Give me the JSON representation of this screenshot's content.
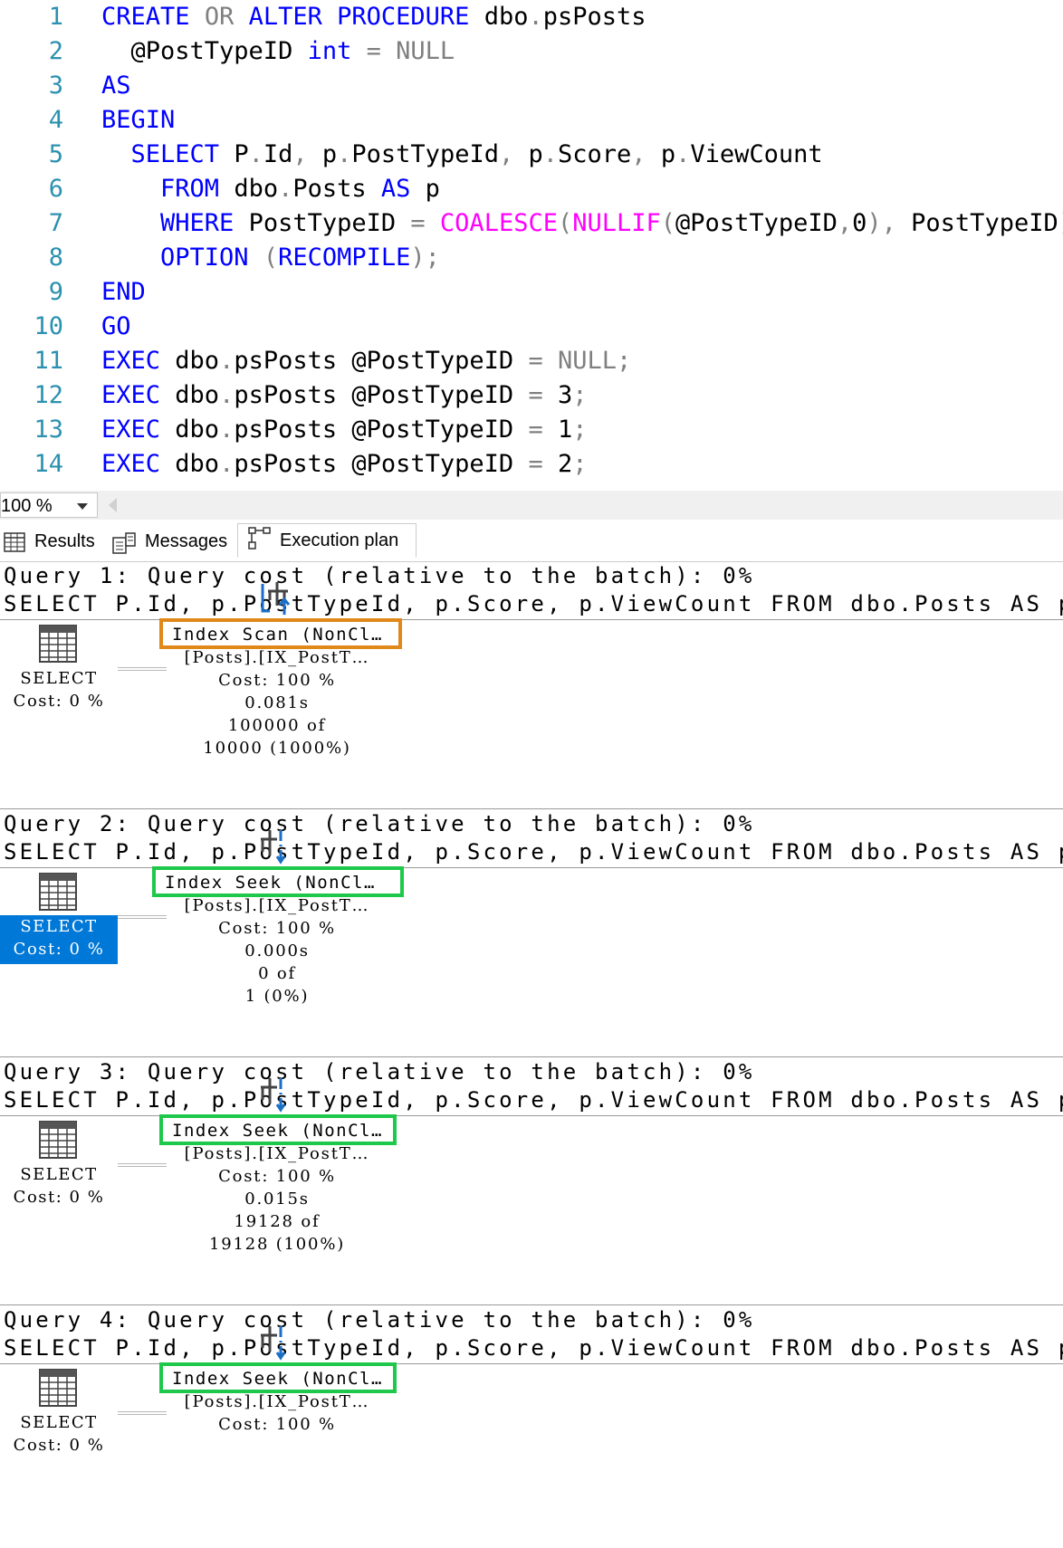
{
  "editor": {
    "lines": [
      {
        "n": "1",
        "tokens": [
          {
            "t": "CREATE",
            "c": "kw"
          },
          {
            "t": " "
          },
          {
            "t": "OR",
            "c": "op"
          },
          {
            "t": " "
          },
          {
            "t": "ALTER",
            "c": "kw"
          },
          {
            "t": " "
          },
          {
            "t": "PROCEDURE",
            "c": "kw"
          },
          {
            "t": " dbo"
          },
          {
            "t": ".",
            "c": "op"
          },
          {
            "t": "psPosts"
          }
        ]
      },
      {
        "n": "2",
        "tokens": [
          {
            "t": "  @PostTypeID "
          },
          {
            "t": "int",
            "c": "kw"
          },
          {
            "t": " "
          },
          {
            "t": "=",
            "c": "op"
          },
          {
            "t": " "
          },
          {
            "t": "NULL",
            "c": "op"
          }
        ]
      },
      {
        "n": "3",
        "tokens": [
          {
            "t": "AS",
            "c": "kw"
          }
        ]
      },
      {
        "n": "4",
        "tokens": [
          {
            "t": "BEGIN",
            "c": "kw"
          }
        ]
      },
      {
        "n": "5",
        "tokens": [
          {
            "t": "  "
          },
          {
            "t": "SELECT",
            "c": "kw"
          },
          {
            "t": " P"
          },
          {
            "t": ".",
            "c": "op"
          },
          {
            "t": "Id"
          },
          {
            "t": ",",
            "c": "op"
          },
          {
            "t": " p"
          },
          {
            "t": ".",
            "c": "op"
          },
          {
            "t": "PostTypeId"
          },
          {
            "t": ",",
            "c": "op"
          },
          {
            "t": " p"
          },
          {
            "t": ".",
            "c": "op"
          },
          {
            "t": "Score"
          },
          {
            "t": ",",
            "c": "op"
          },
          {
            "t": " p"
          },
          {
            "t": ".",
            "c": "op"
          },
          {
            "t": "ViewCount"
          }
        ]
      },
      {
        "n": "6",
        "tokens": [
          {
            "t": "    "
          },
          {
            "t": "FROM",
            "c": "kw"
          },
          {
            "t": " dbo"
          },
          {
            "t": ".",
            "c": "op"
          },
          {
            "t": "Posts "
          },
          {
            "t": "AS",
            "c": "kw"
          },
          {
            "t": " p"
          }
        ]
      },
      {
        "n": "7",
        "tokens": [
          {
            "t": "    "
          },
          {
            "t": "WHERE",
            "c": "kw"
          },
          {
            "t": " PostTypeID "
          },
          {
            "t": "=",
            "c": "op"
          },
          {
            "t": " "
          },
          {
            "t": "COALESCE",
            "c": "fn"
          },
          {
            "t": "(",
            "c": "op"
          },
          {
            "t": "NULLIF",
            "c": "fn"
          },
          {
            "t": "(",
            "c": "op"
          },
          {
            "t": "@PostTypeID"
          },
          {
            "t": ",",
            "c": "op"
          },
          {
            "t": "0"
          },
          {
            "t": "),",
            "c": "op"
          },
          {
            "t": " PostTypeID"
          },
          {
            "t": ")",
            "c": "op"
          }
        ]
      },
      {
        "n": "8",
        "tokens": [
          {
            "t": "    "
          },
          {
            "t": "OPTION",
            "c": "kw"
          },
          {
            "t": " "
          },
          {
            "t": "(",
            "c": "op"
          },
          {
            "t": "RECOMPILE",
            "c": "kw"
          },
          {
            "t": ");",
            "c": "op"
          }
        ]
      },
      {
        "n": "9",
        "tokens": [
          {
            "t": "END",
            "c": "kw"
          }
        ]
      },
      {
        "n": "10",
        "tokens": [
          {
            "t": "GO",
            "c": "kw"
          }
        ]
      },
      {
        "n": "11",
        "tokens": [
          {
            "t": "EXEC",
            "c": "kw"
          },
          {
            "t": " dbo"
          },
          {
            "t": ".",
            "c": "op"
          },
          {
            "t": "psPosts @PostTypeID "
          },
          {
            "t": "=",
            "c": "op"
          },
          {
            "t": " "
          },
          {
            "t": "NULL;",
            "c": "op"
          }
        ]
      },
      {
        "n": "12",
        "tokens": [
          {
            "t": "EXEC",
            "c": "kw"
          },
          {
            "t": " dbo"
          },
          {
            "t": ".",
            "c": "op"
          },
          {
            "t": "psPosts @PostTypeID "
          },
          {
            "t": "=",
            "c": "op"
          },
          {
            "t": " 3"
          },
          {
            "t": ";",
            "c": "op"
          }
        ]
      },
      {
        "n": "13",
        "tokens": [
          {
            "t": "EXEC",
            "c": "kw"
          },
          {
            "t": " dbo"
          },
          {
            "t": ".",
            "c": "op"
          },
          {
            "t": "psPosts @PostTypeID "
          },
          {
            "t": "=",
            "c": "op"
          },
          {
            "t": " 1"
          },
          {
            "t": ";",
            "c": "op"
          }
        ]
      },
      {
        "n": "14",
        "tokens": [
          {
            "t": "EXEC",
            "c": "kw"
          },
          {
            "t": " dbo"
          },
          {
            "t": ".",
            "c": "op"
          },
          {
            "t": "psPosts @PostTypeID "
          },
          {
            "t": "=",
            "c": "op"
          },
          {
            "t": " 2"
          },
          {
            "t": ";",
            "c": "op"
          }
        ]
      }
    ]
  },
  "zoom": {
    "value": "100 %"
  },
  "tabs": {
    "results": "Results",
    "messages": "Messages",
    "execution_plan": "Execution plan"
  },
  "queries": [
    {
      "header": "Query 1: Query cost (relative to the batch): 0%",
      "sql": "SELECT P.Id, p.PostTypeId, p.Score, p.ViewCount FROM dbo.Posts AS p WHE",
      "select_label": "SELECT",
      "select_cost": "Cost: 0 %",
      "select_highlighted": false,
      "op_title": "Index Scan (NonCl…",
      "op_border": "orange",
      "op_object": "[Posts].[IX_PostT…",
      "op_cost": "Cost: 100 %",
      "op_time": "0.081s",
      "op_rows_a": "100000 of",
      "op_rows_b": "10000 (1000%)",
      "op_icon": "index-scan-icon"
    },
    {
      "header": "Query 2: Query cost (relative to the batch): 0%",
      "sql": "SELECT P.Id, p.PostTypeId, p.Score, p.ViewCount FROM dbo.Posts AS p WHE",
      "select_label": "SELECT",
      "select_cost": "Cost: 0 %",
      "select_highlighted": true,
      "op_title": "Index Seek (NonCl…",
      "op_border": "green",
      "op_object": "[Posts].[IX_PostT…",
      "op_cost": "Cost: 100 %",
      "op_time": "0.000s",
      "op_rows_a": "0 of",
      "op_rows_b": "1 (0%)",
      "op_icon": "index-seek-icon"
    },
    {
      "header": "Query 3: Query cost (relative to the batch): 0%",
      "sql": "SELECT P.Id, p.PostTypeId, p.Score, p.ViewCount FROM dbo.Posts AS p WHE",
      "select_label": "SELECT",
      "select_cost": "Cost: 0 %",
      "select_highlighted": false,
      "op_title": "Index Seek (NonCl…",
      "op_border": "green",
      "op_object": "[Posts].[IX_PostT…",
      "op_cost": "Cost: 100 %",
      "op_time": "0.015s",
      "op_rows_a": "19128 of",
      "op_rows_b": "19128 (100%)",
      "op_icon": "index-seek-icon"
    },
    {
      "header": "Query 4: Query cost (relative to the batch): 0%",
      "sql": "SELECT P.Id, p.PostTypeId, p.Score, p.ViewCount FROM dbo.Posts AS p WHE",
      "select_label": "SELECT",
      "select_cost": "Cost: 0 %",
      "select_highlighted": false,
      "op_title": "Index Seek (NonCl…",
      "op_border": "green",
      "op_object": "[Posts].[IX_PostT…",
      "op_cost": "Cost: 100 %",
      "op_time": "",
      "op_rows_a": "",
      "op_rows_b": "",
      "op_icon": "index-seek-icon"
    }
  ],
  "colors": {
    "keyword": "#0000ff",
    "function": "#ff00ff",
    "operator": "#808080",
    "line_number": "#2b91af",
    "scan_border": "#e0881a",
    "seek_border": "#1ec84a",
    "selection": "#0078d7"
  }
}
